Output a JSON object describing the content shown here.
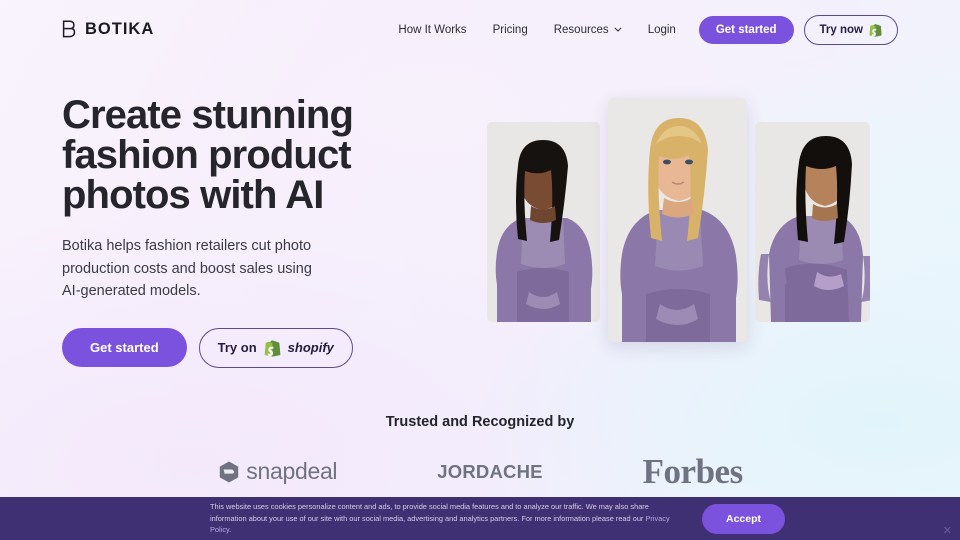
{
  "brand": {
    "name": "BOTIKA",
    "mark_icon": "botika-b-monogram-icon"
  },
  "nav": {
    "links": [
      {
        "label": "How It Works"
      },
      {
        "label": "Pricing"
      },
      {
        "label": "Resources",
        "icon": "chevron-down-icon"
      },
      {
        "label": "Login"
      }
    ],
    "get_started_label": "Get started",
    "try_now_label": "Try now",
    "try_now_icon": "shopify-bag-icon"
  },
  "hero": {
    "heading": "Create stunning fashion product photos with AI",
    "subheading": "Botika helps fashion retailers cut photo production costs and boost sales using AI-generated models.",
    "cta_primary": "Get started",
    "cta_secondary_prefix": "Try on",
    "cta_secondary_brand": "shopify",
    "cta_secondary_icon": "shopify-bag-icon",
    "images": [
      {
        "alt": "model-wearing-purple-long-sleeve-crop-top-front"
      },
      {
        "alt": "model-wearing-purple-activewear-set-center"
      },
      {
        "alt": "model-wearing-purple-activewear-back-view"
      }
    ]
  },
  "trusted": {
    "title": "Trusted and Recognized by",
    "logos": [
      {
        "name": "snapdeal",
        "icon": "snapdeal-hexagon-icon"
      },
      {
        "name": "JORDACHE"
      },
      {
        "name": "Forbes"
      }
    ]
  },
  "cookie_banner": {
    "text_before_link": "This website uses cookies personalize content and ads, to provide social media features and to analyze our traffic. We may also share information about your use of our site with our social media, advertising and analytics partners. For more information please read our ",
    "link_label": "Privacy Policy",
    "text_after_link": ".",
    "accept_label": "Accept",
    "close_icon": "close-icon"
  },
  "colors": {
    "accent_purple": "#7b52de",
    "banner_purple": "#3f2f73",
    "heading_dark": "#25252b",
    "logo_grey": "#6f7381",
    "shopify_green": "#6bb544"
  }
}
